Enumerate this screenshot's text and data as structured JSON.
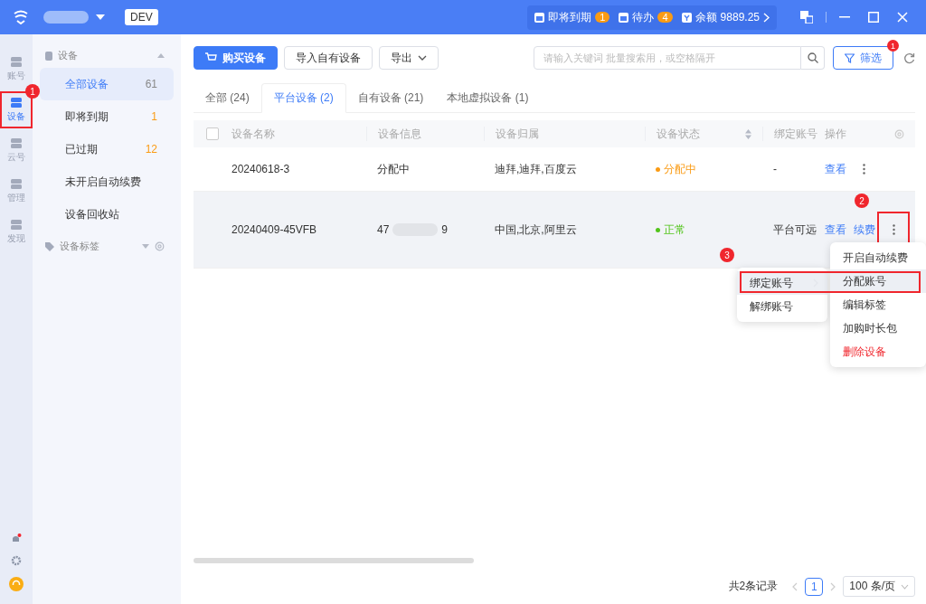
{
  "title_bar": {
    "env_badge": "DEV",
    "reminders": [
      {
        "label": "即将到期",
        "count": "1"
      },
      {
        "label": "待办",
        "count": "4"
      }
    ],
    "balance": {
      "label": "余额",
      "value": "9889.25"
    }
  },
  "rail": {
    "items": [
      {
        "label": "账号",
        "selected": false,
        "outlined": false
      },
      {
        "label": "设备",
        "selected": true,
        "outlined": true
      },
      {
        "label": "云号",
        "selected": false,
        "outlined": false
      },
      {
        "label": "管理",
        "selected": false,
        "outlined": false
      },
      {
        "label": "发现",
        "selected": false,
        "outlined": false
      }
    ]
  },
  "sidebar": {
    "group": "设备",
    "expanded": true,
    "items": [
      {
        "label": "全部设备",
        "count": "61",
        "selected": true
      },
      {
        "label": "即将到期",
        "count": "1",
        "selected": false
      },
      {
        "label": "已过期",
        "count": "12",
        "selected": false
      },
      {
        "label": "未开启自动续费",
        "selected": false
      },
      {
        "label": "设备回收站",
        "selected": false
      }
    ],
    "tags_group": "设备标签"
  },
  "toolbar": {
    "buttons": [
      {
        "label": "购买设备",
        "kind": "primary"
      },
      {
        "label": "导入自有设备",
        "kind": "plain"
      },
      {
        "label": "导出",
        "kind": "dropdown"
      }
    ],
    "search": {
      "placeholder": "请输入关键词 批量搜索用，或空格隔开"
    },
    "filter": {
      "label": "筛选",
      "badge": "1"
    }
  },
  "tabs": [
    {
      "label": "全部 (24)",
      "selected": false
    },
    {
      "label": "平台设备 (2)",
      "selected": true
    },
    {
      "label": "自有设备 (21)",
      "selected": false
    },
    {
      "label": "本地虚拟设备 (1)",
      "selected": false
    }
  ],
  "table": {
    "select_all": {
      "checked": false
    },
    "columns": [
      "设备名称",
      "设备信息",
      "设备归属",
      "设备状态",
      "绑定账号",
      "操作"
    ],
    "rows": [
      {
        "name": "20240618-3",
        "info": [
          "分配中"
        ],
        "owner": "迪拜,迪拜,百度云",
        "status": {
          "label": "分配中",
          "color": "#fa9b14"
        },
        "account": "-",
        "actions": [
          "查看"
        ],
        "hovered": false,
        "more_outlined": false
      },
      {
        "name": "20240409-45VFB",
        "info": [
          "47",
          "9"
        ],
        "owner": "中国,北京,阿里云",
        "status": {
          "label": "正常",
          "color": "#52c41a"
        },
        "account": "平台可远",
        "actions": [
          "查看",
          "续费"
        ],
        "hovered": true,
        "more_outlined": true
      }
    ]
  },
  "context_menu": {
    "items": [
      {
        "label": "开启自动续费",
        "kind": "plain",
        "selected": false
      },
      {
        "label": "分配账号",
        "kind": "submenu",
        "selected": true
      },
      {
        "label": "编辑标签",
        "kind": "plain",
        "selected": false
      },
      {
        "label": "加购时长包",
        "kind": "plain",
        "selected": false
      },
      {
        "label": "删除设备",
        "kind": "danger",
        "selected": false
      }
    ],
    "submenu": [
      {
        "label": "绑定账号",
        "selected": true
      },
      {
        "label": "解绑账号",
        "selected": false
      }
    ]
  },
  "annotations": [
    {
      "label": "1"
    },
    {
      "label": "2"
    },
    {
      "label": "3"
    }
  ],
  "pagination": {
    "total": "共2条记录",
    "pages": [
      {
        "label": "1",
        "selected": true
      }
    ],
    "page_size": "100 条/页"
  }
}
